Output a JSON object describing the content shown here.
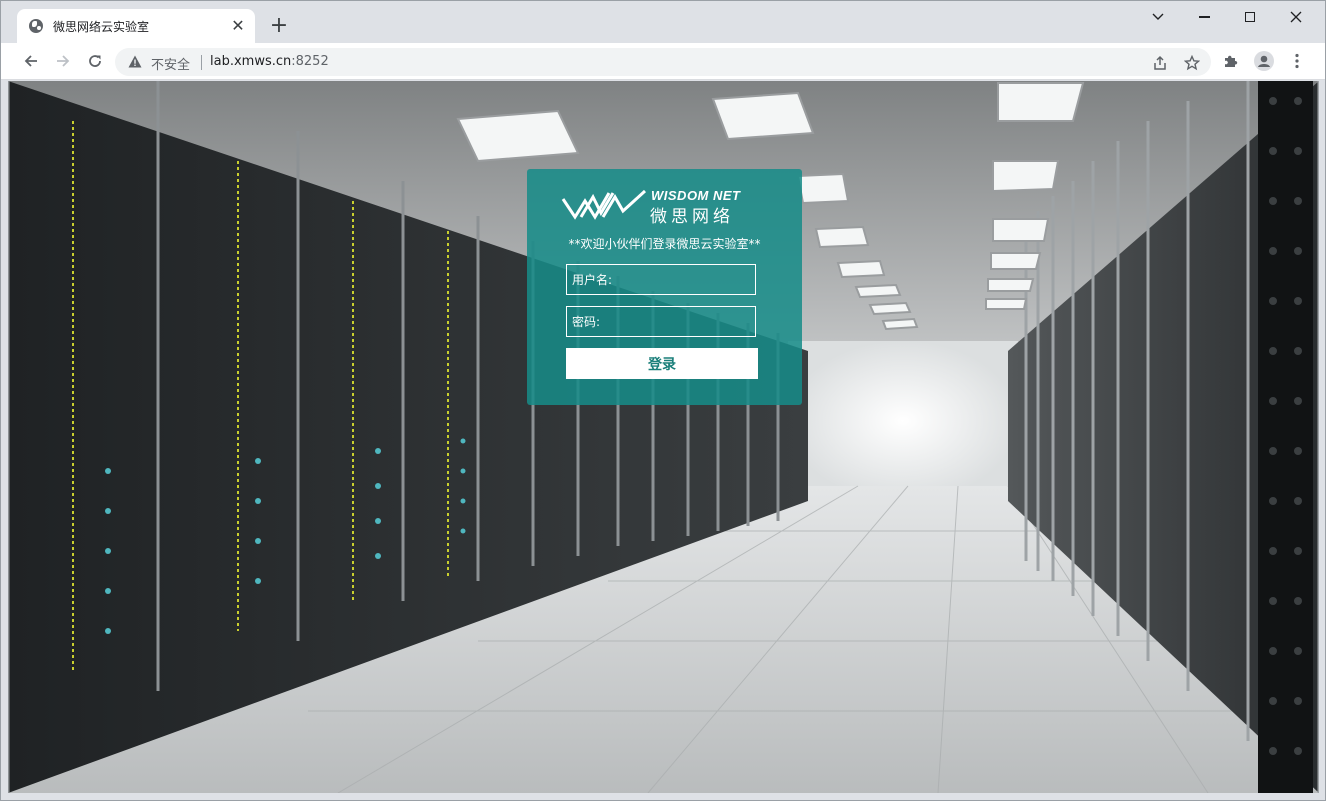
{
  "browser": {
    "tab": {
      "title": "微思网络云实验室",
      "close": "✕"
    },
    "new_tab": "+",
    "address": {
      "security_label": "不安全",
      "host": "lab.xmws.cn",
      "port": ":8252"
    }
  },
  "login": {
    "logo": {
      "en": "WISDOM NET",
      "cn": "微思网络"
    },
    "welcome": "**欢迎小伙伴们登录微思云实验室**",
    "username_placeholder": "用户名:",
    "password_placeholder": "密码:",
    "submit_label": "登录"
  },
  "colors": {
    "card": "#168c88",
    "button_text": "#1a7f7a"
  }
}
